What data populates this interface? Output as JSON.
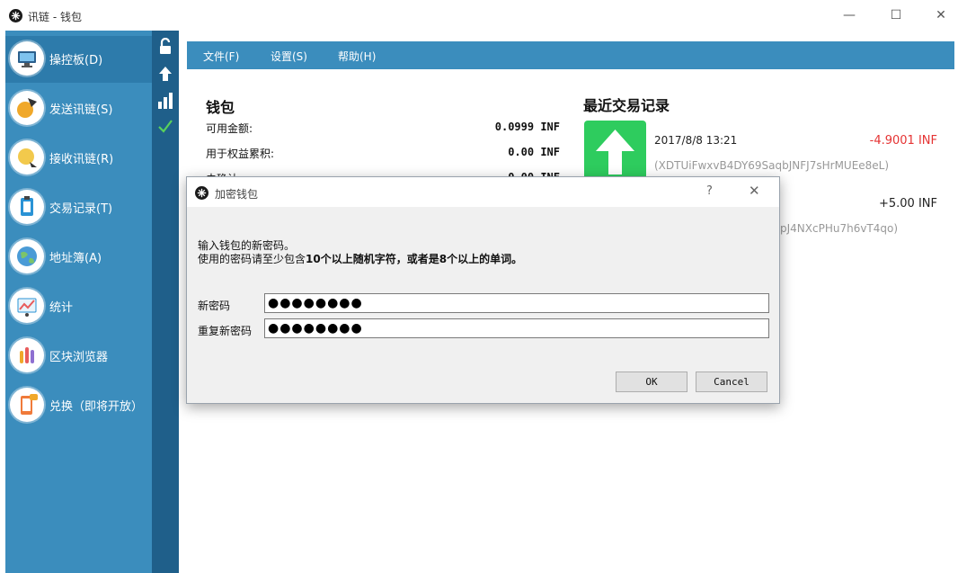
{
  "window": {
    "title": "讯链 - 钱包",
    "minimize": "—",
    "maximize": "☐",
    "close": "✕"
  },
  "sidebar": {
    "items": [
      {
        "label": "操控板(D)",
        "icon": "monitor-icon",
        "color": "#2b7bb6"
      },
      {
        "label": "发送讯链(S)",
        "icon": "send-icon",
        "color": "#f0a82a"
      },
      {
        "label": "接收讯链(R)",
        "icon": "receive-icon",
        "color": "#f2c94c"
      },
      {
        "label": "交易记录(T)",
        "icon": "clipboard-icon",
        "color": "#2a93d5"
      },
      {
        "label": "地址簿(A)",
        "icon": "globe-icon",
        "color": "#4a9bd6"
      },
      {
        "label": "统计",
        "icon": "chart-icon",
        "color": "#e85c5c"
      },
      {
        "label": "区块浏览器",
        "icon": "test-tubes-icon",
        "color": "#8e6fd1"
      },
      {
        "label": "兑换（即将开放）",
        "icon": "phone-icon",
        "color": "#f07a3a"
      }
    ]
  },
  "strip": {
    "icons": [
      "unlock-icon",
      "upload-arrow-icon",
      "signal-bars-icon",
      "checkmark-icon"
    ]
  },
  "menu": {
    "file": "文件(F)",
    "settings": "设置(S)",
    "help": "帮助(H)"
  },
  "wallet": {
    "title": "钱包",
    "available_label": "可用金额:",
    "available_value": "0.0999 INF",
    "staking_label": "用于权益累积:",
    "staking_value": "0.00 INF",
    "unconfirmed_label": "未确认:",
    "unconfirmed_value": "0.00 INF"
  },
  "recent": {
    "title": "最近交易记录",
    "transactions": [
      {
        "date": "2017/8/8 13:21",
        "amount": "-4.9001 INF",
        "address": "(XDTUiFwxvB4DY69SaqbJNFJ7sHrMUEe8eL)"
      },
      {
        "amount": "+5.00 INF",
        "address": "pJ4NXcPHu7h6vT4qo)"
      }
    ]
  },
  "dialog": {
    "title": "加密钱包",
    "help": "?",
    "close": "✕",
    "message_line1": "输入钱包的新密码。",
    "message_line2_prefix": "使用的密码请至少包含",
    "message_line2_bold": "10个以上随机字符，或者是8个以上的单词。",
    "new_password_label": "新密码",
    "new_password_value": "●●●●●●●●",
    "repeat_password_label": "重复新密码",
    "repeat_password_value": "●●●●●●●●",
    "ok_label": "OK",
    "cancel_label": "Cancel"
  },
  "colors": {
    "sidebar": "#3b8dbd",
    "strip": "#1f5f8a",
    "tx_icon": "#2ecc5e",
    "negative": "#e53333"
  }
}
